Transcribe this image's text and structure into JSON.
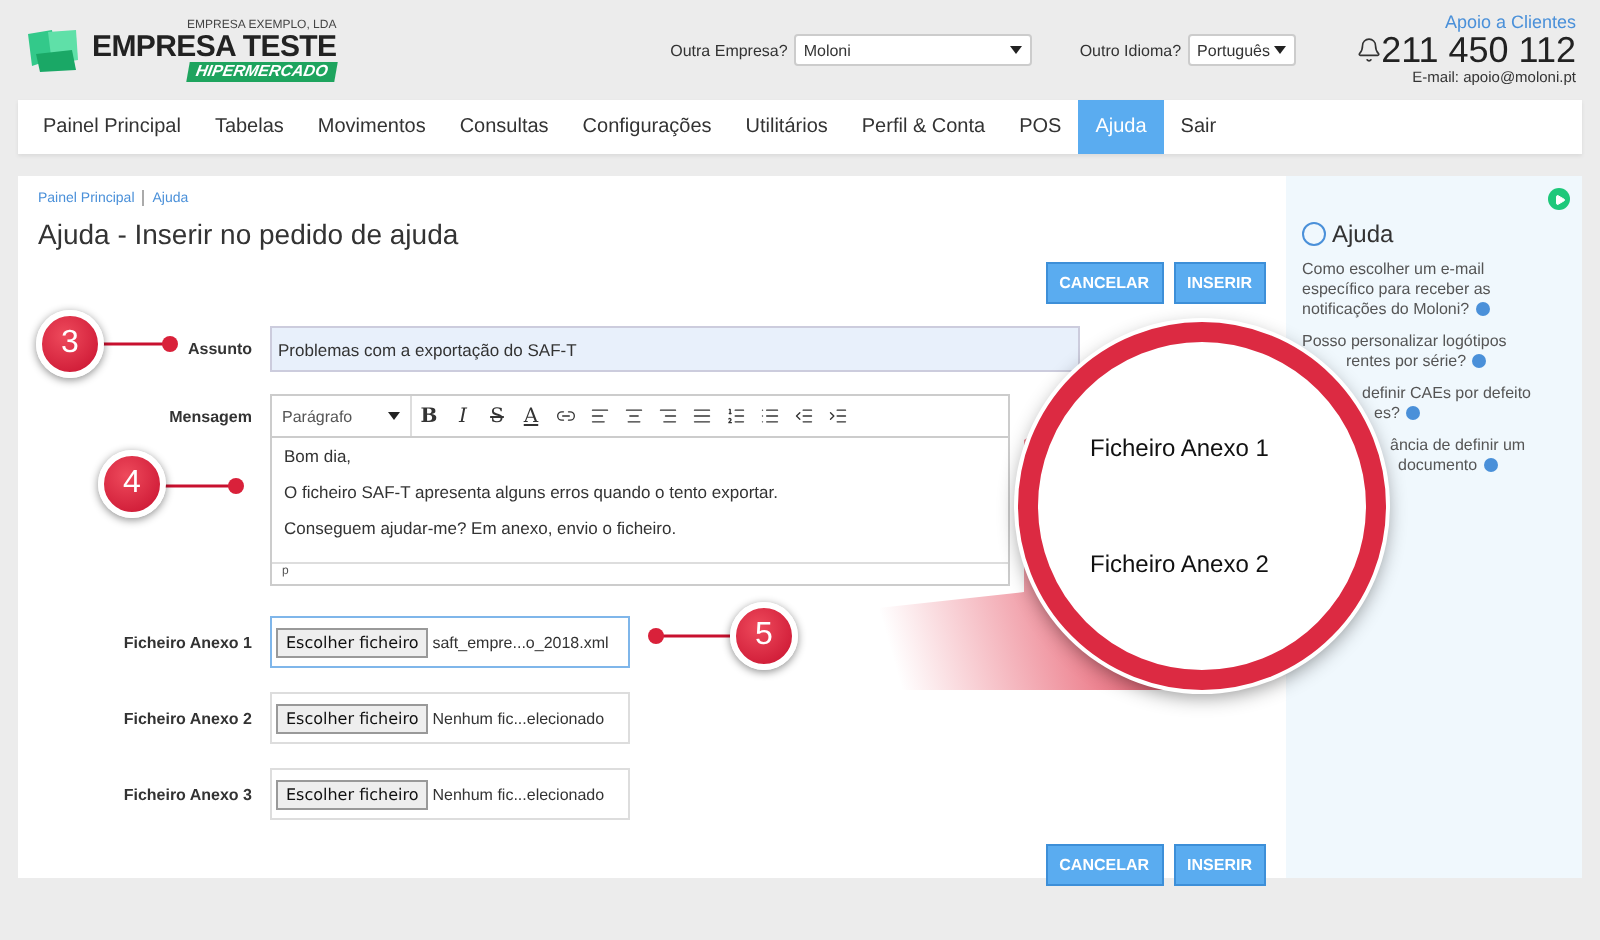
{
  "company": {
    "subtitle": "EMPRESA EXEMPLO, LDA",
    "name": "EMPRESA TESTE",
    "tag": "HIPERMERCADO"
  },
  "company_select": {
    "label": "Outra Empresa?",
    "value": "Moloni"
  },
  "language_select": {
    "label": "Outro Idioma?",
    "value": "Português"
  },
  "support": {
    "title": "Apoio a Clientes",
    "phone": "211 450 112",
    "email": "E-mail: apoio@moloni.pt"
  },
  "nav": [
    {
      "label": "Painel Principal",
      "selected": false
    },
    {
      "label": "Tabelas",
      "selected": false
    },
    {
      "label": "Movimentos",
      "selected": false
    },
    {
      "label": "Consultas",
      "selected": false
    },
    {
      "label": "Configurações",
      "selected": false
    },
    {
      "label": "Utilitários",
      "selected": false
    },
    {
      "label": "Perfil & Conta",
      "selected": false
    },
    {
      "label": "POS",
      "selected": false
    },
    {
      "label": "Ajuda",
      "selected": true
    },
    {
      "label": "Sair",
      "selected": false
    }
  ],
  "breadcrumb": [
    "Painel Principal",
    "Ajuda"
  ],
  "page_title": "Ajuda - Inserir no pedido de ajuda",
  "top_actions": [
    "CANCELAR",
    "INSERIR"
  ],
  "subject": {
    "label": "Assunto",
    "value": "Problemas com a exportação do SAF-T"
  },
  "message": {
    "label": "Mensagem",
    "format": "Parágrafo",
    "toolbar": [
      "B",
      "I",
      "S",
      "A"
    ],
    "lines": [
      "Bom dia,",
      "O ficheiro SAF-T apresenta alguns erros quando o tento exportar.",
      "Conseguem ajudar-me? Em anexo, envio o ficheiro."
    ],
    "path": "p"
  },
  "attachments": [
    {
      "label": "Ficheiro Anexo 1",
      "button": "Escolher ficheiro",
      "file": "saft_empre...o_2018.xml",
      "focused": true
    },
    {
      "label": "Ficheiro Anexo 2",
      "button": "Escolher ficheiro",
      "file": "Nenhum fic...elecionado",
      "focused": false
    },
    {
      "label": "Ficheiro Anexo 3",
      "button": "Escolher ficheiro",
      "file": "Nenhum fic...elecionado",
      "focused": false
    }
  ],
  "bottom_actions": [
    "CANCELAR",
    "INSERIR"
  ],
  "help": {
    "title": "Ajuda",
    "items": [
      {
        "lines": [
          "Como escolher um e-mail",
          "específico para receber as",
          "notificações do Moloni?"
        ]
      },
      {
        "lines": [
          "Posso personalizar logótipos",
          "rentes por série?"
        ]
      },
      {
        "lines": [
          "definir CAEs por defeito",
          "es?"
        ]
      },
      {
        "lines": [
          "ância de definir um",
          "documento"
        ]
      }
    ]
  },
  "callouts": [
    "3",
    "4",
    "5"
  ],
  "magnifier": {
    "lines": [
      "Ficheiro Anexo 1",
      "Ficheiro Anexo 2"
    ]
  }
}
